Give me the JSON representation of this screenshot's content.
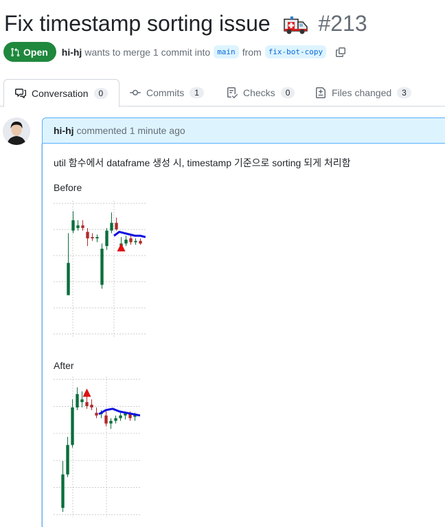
{
  "pr": {
    "title": "Fix timestamp sorting issue",
    "number": "#213",
    "state": "Open",
    "author": "hi-hj",
    "merge_text": "wants to merge 1 commit into",
    "base_branch": "main",
    "from_text": "from",
    "head_branch": "fix-bot-copy"
  },
  "tabs": [
    {
      "label": "Conversation",
      "count": "0",
      "icon": "comment-discussion-icon"
    },
    {
      "label": "Commits",
      "count": "1",
      "icon": "git-commit-icon"
    },
    {
      "label": "Checks",
      "count": "0",
      "icon": "checklist-icon"
    },
    {
      "label": "Files changed",
      "count": "3",
      "icon": "file-diff-icon"
    }
  ],
  "comment": {
    "author": "hi-hj",
    "action": "commented",
    "time": "1 minute ago",
    "body": "util 함수에서 dataframe 생성 시, timestamp 기준으로 sorting 되게 처리함",
    "before_label": "Before",
    "after_label": "After"
  },
  "colors": {
    "open_green": "#1f883d",
    "accent_blue": "#0969da",
    "header_bg": "#ddf4ff",
    "candle_up": "#0b6e3c",
    "candle_down": "#b02a2a",
    "ma_line": "#1010e0",
    "signal_marker": "#e01010"
  },
  "chart_data": [
    {
      "type": "candlestick",
      "title": "Before",
      "candles": [
        {
          "o": 30,
          "h": 78,
          "l": 45,
          "c": 55,
          "dir": "up"
        },
        {
          "o": 80,
          "h": 95,
          "l": 78,
          "c": 88,
          "dir": "up"
        },
        {
          "o": 82,
          "h": 88,
          "l": 80,
          "c": 84,
          "dir": "up"
        },
        {
          "o": 84,
          "h": 88,
          "l": 80,
          "c": 82,
          "dir": "down"
        },
        {
          "o": 79,
          "h": 82,
          "l": 68,
          "c": 74,
          "dir": "down"
        },
        {
          "o": 75,
          "h": 78,
          "l": 72,
          "c": 74,
          "dir": "down"
        },
        {
          "o": 74,
          "h": 77,
          "l": 71,
          "c": 75,
          "dir": "up"
        },
        {
          "o": 38,
          "h": 70,
          "l": 35,
          "c": 66,
          "dir": "up"
        },
        {
          "o": 68,
          "h": 82,
          "l": 65,
          "c": 80,
          "dir": "up"
        },
        {
          "o": 80,
          "h": 94,
          "l": 78,
          "c": 86,
          "dir": "up"
        },
        {
          "o": 86,
          "h": 90,
          "l": 80,
          "c": 81,
          "dir": "down"
        },
        {
          "o": 68,
          "h": 75,
          "l": 66,
          "c": 70,
          "dir": "up"
        },
        {
          "o": 70,
          "h": 76,
          "l": 68,
          "c": 73,
          "dir": "up"
        },
        {
          "o": 74,
          "h": 76,
          "l": 69,
          "c": 71,
          "dir": "down"
        },
        {
          "o": 71,
          "h": 74,
          "l": 69,
          "c": 72,
          "dir": "up"
        },
        {
          "o": 72,
          "h": 74,
          "l": 69,
          "c": 70,
          "dir": "down"
        }
      ],
      "ma_line": [
        76,
        79,
        78,
        77,
        76,
        76,
        75
      ],
      "marker": {
        "index": 11,
        "value": 66
      }
    },
    {
      "type": "candlestick",
      "title": "After",
      "candles": [
        {
          "o": 5,
          "h": 40,
          "l": 2,
          "c": 30,
          "dir": "up"
        },
        {
          "o": 30,
          "h": 58,
          "l": 28,
          "c": 52,
          "dir": "up"
        },
        {
          "o": 52,
          "h": 86,
          "l": 50,
          "c": 80,
          "dir": "up"
        },
        {
          "o": 80,
          "h": 95,
          "l": 78,
          "c": 90,
          "dir": "up"
        },
        {
          "o": 86,
          "h": 92,
          "l": 80,
          "c": 84,
          "dir": "up"
        },
        {
          "o": 84,
          "h": 88,
          "l": 79,
          "c": 81,
          "dir": "down"
        },
        {
          "o": 82,
          "h": 86,
          "l": 78,
          "c": 80,
          "dir": "down"
        },
        {
          "o": 76,
          "h": 80,
          "l": 72,
          "c": 74,
          "dir": "down"
        },
        {
          "o": 76,
          "h": 78,
          "l": 72,
          "c": 75,
          "dir": "up"
        },
        {
          "o": 74,
          "h": 78,
          "l": 66,
          "c": 68,
          "dir": "down"
        },
        {
          "o": 68,
          "h": 72,
          "l": 64,
          "c": 70,
          "dir": "up"
        },
        {
          "o": 70,
          "h": 74,
          "l": 68,
          "c": 72,
          "dir": "up"
        },
        {
          "o": 72,
          "h": 76,
          "l": 70,
          "c": 74,
          "dir": "up"
        },
        {
          "o": 74,
          "h": 77,
          "l": 71,
          "c": 76,
          "dir": "up"
        },
        {
          "o": 75,
          "h": 77,
          "l": 70,
          "c": 72,
          "dir": "down"
        },
        {
          "o": 73,
          "h": 76,
          "l": 70,
          "c": 75,
          "dir": "up"
        }
      ],
      "ma_line": [
        75,
        78,
        79,
        77,
        76,
        75,
        74
      ],
      "marker": {
        "index": 5,
        "value": 90
      }
    }
  ]
}
